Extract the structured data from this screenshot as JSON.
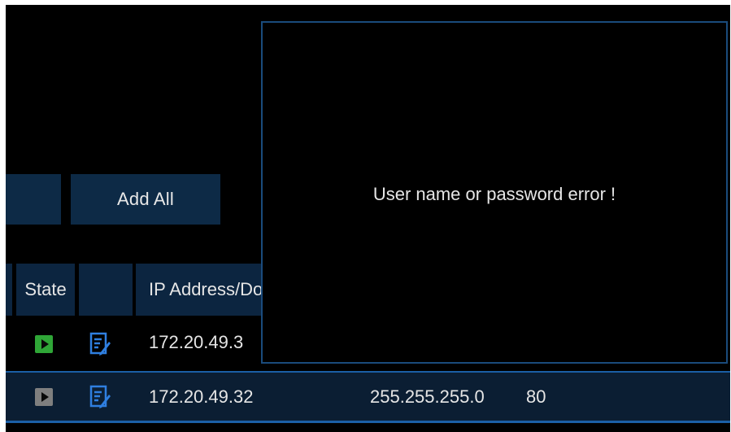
{
  "toolbar": {
    "left_button_label": "",
    "add_all_label": "Add All"
  },
  "table": {
    "headers": {
      "state": "State",
      "edit": "",
      "ip": "IP Address/Domain"
    },
    "rows": [
      {
        "state": "connected",
        "ip": "172.20.49.3",
        "mask": "",
        "port": ""
      },
      {
        "state": "disconnected",
        "ip": "172.20.49.32",
        "mask": "255.255.255.0",
        "port": "80"
      }
    ]
  },
  "dialog": {
    "message": "User name or password error !"
  },
  "colors": {
    "accent": "#1b5fa6",
    "button_bg": "#0d2a46",
    "state_online": "#2fa637",
    "state_offline": "#7f7f7f",
    "edit_icon": "#2f7fe0"
  }
}
